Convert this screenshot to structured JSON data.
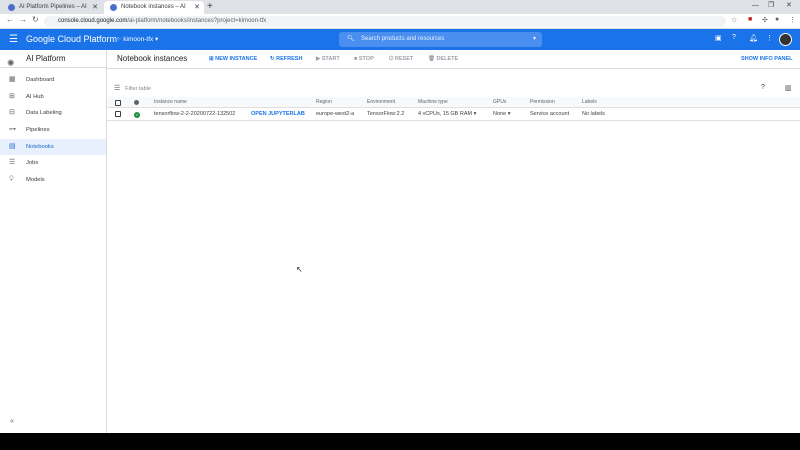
{
  "browser": {
    "tabs": [
      {
        "label": "AI Platform Pipelines – AI Platform"
      },
      {
        "label": "Notebook instances – AI Platform"
      }
    ],
    "url_host": "console.cloud.google.com",
    "url_path": "/ai-platform/notebooks/instances?project=kimoon-tfx"
  },
  "header": {
    "brand": "Google Cloud Platform",
    "project": "kimoon-tfx",
    "search_placeholder": "Search products and resources"
  },
  "sidebar": {
    "title": "AI Platform",
    "items": [
      {
        "label": "Dashboard",
        "icon": "dashboard-icon"
      },
      {
        "label": "AI Hub",
        "icon": "hub-icon"
      },
      {
        "label": "Data Labeling",
        "icon": "label-icon"
      },
      {
        "label": "Pipelines",
        "icon": "pipeline-icon"
      },
      {
        "label": "Notebooks",
        "icon": "notebook-icon",
        "selected": true
      },
      {
        "label": "Jobs",
        "icon": "list-icon"
      },
      {
        "label": "Models",
        "icon": "lightbulb-icon"
      }
    ]
  },
  "toolbar": {
    "title": "Notebook instances",
    "new_instance": "NEW INSTANCE",
    "refresh": "REFRESH",
    "start": "START",
    "stop": "STOP",
    "reset": "RESET",
    "delete": "DELETE",
    "show_info": "SHOW INFO PANEL"
  },
  "filter": {
    "placeholder": "Filter table"
  },
  "table": {
    "columns": [
      "Instance name",
      "Region",
      "Environment",
      "Machine type",
      "GPUs",
      "Permission",
      "Labels"
    ],
    "rows": [
      {
        "name": "tensorflow-2-2-20200722-132502",
        "action": "OPEN JUPYTERLAB",
        "region": "europe-west2-a",
        "environment": "TensorFlow:2.2",
        "machine": "4 vCPUs, 15 GB RAM",
        "gpus": "None",
        "permission": "Service account",
        "labels": "No labels",
        "status": "running"
      }
    ]
  },
  "colors": {
    "accent": "#1a73e8",
    "status_ok": "#1e8e3e"
  }
}
